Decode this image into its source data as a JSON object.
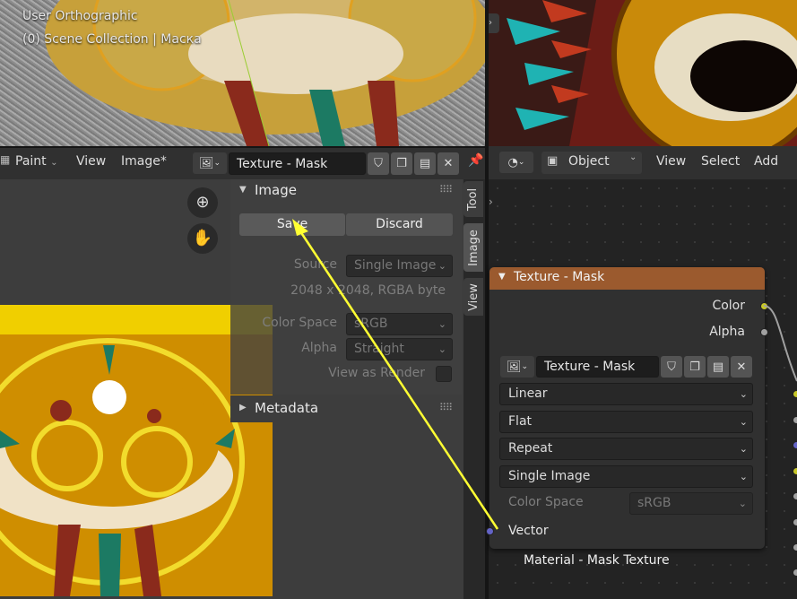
{
  "viewport": {
    "view_name": "User Orthographic",
    "collection": "(0) Scene Collection | Маска"
  },
  "image_editor": {
    "mode": "Paint",
    "menus": [
      "View",
      "Image*"
    ],
    "image_name": "Texture - Mask",
    "panel": {
      "title": "Image",
      "save_label": "Save",
      "discard_label": "Discard",
      "source_label": "Source",
      "source_value": "Single Image",
      "info": "2048 x 2048,  RGBA byte",
      "color_space_label": "Color Space",
      "color_space_value": "sRGB",
      "alpha_label": "Alpha",
      "alpha_value": "Straight",
      "view_as_render_label": "View as Render",
      "metadata_title": "Metadata"
    },
    "tabs": [
      "Tool",
      "Image",
      "View"
    ]
  },
  "node_editor": {
    "object_mode": "Object",
    "menus": [
      "View",
      "Select",
      "Add"
    ],
    "node": {
      "title": "Texture - Mask",
      "outputs": [
        "Color",
        "Alpha"
      ],
      "image_name": "Texture - Mask",
      "interpolation": "Linear",
      "projection": "Flat",
      "extension": "Repeat",
      "source": "Single Image",
      "color_space_label": "Color Space",
      "color_space_value": "sRGB",
      "input": "Vector"
    },
    "frame_label": "Material - Mask Texture"
  },
  "colors": {
    "node_header": "#9b5a2e",
    "annotation_arrow": "#ffff33",
    "texture_bg": "#cf8e00"
  }
}
